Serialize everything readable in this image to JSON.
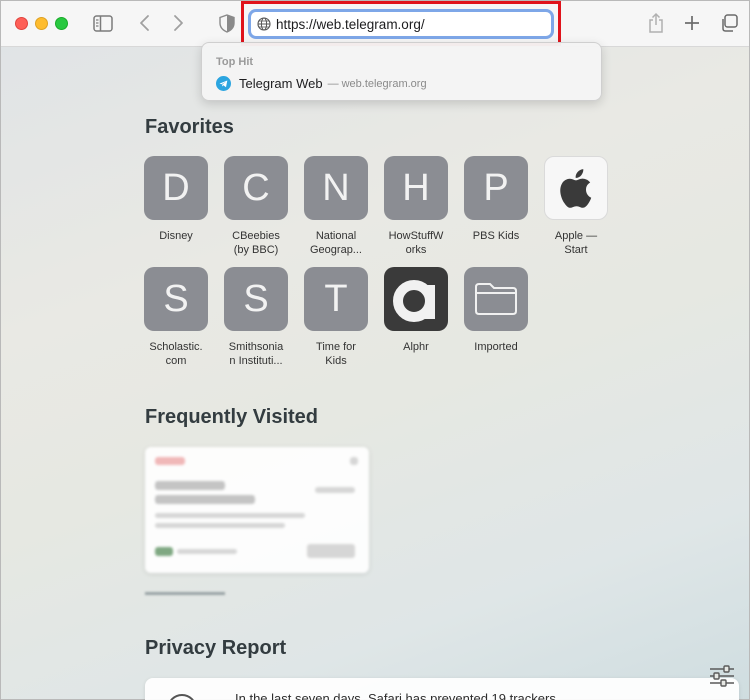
{
  "toolbar": {
    "url": "https://web.telegram.org/"
  },
  "dropdown": {
    "section_label": "Top Hit",
    "suggestion_name": "Telegram Web",
    "suggestion_separator": "—",
    "suggestion_domain": "web.telegram.org"
  },
  "favorites": {
    "title": "Favorites",
    "items": [
      {
        "letter": "D",
        "label": "Disney"
      },
      {
        "letter": "C",
        "label": "CBeebies\n(by BBC)"
      },
      {
        "letter": "N",
        "label": "National\nGeograp..."
      },
      {
        "letter": "H",
        "label": "HowStuffW\norks"
      },
      {
        "letter": "P",
        "label": "PBS Kids"
      },
      {
        "letter": "",
        "label": "Apple —\nStart"
      },
      {
        "letter": "S",
        "label": "Scholastic.\ncom"
      },
      {
        "letter": "S",
        "label": "Smithsonia\nn Instituti..."
      },
      {
        "letter": "T",
        "label": "Time for\nKids"
      },
      {
        "letter": "a",
        "label": "Alphr"
      },
      {
        "letter": "",
        "label": "Imported"
      }
    ]
  },
  "frequently_visited": {
    "title": "Frequently Visited"
  },
  "privacy_report": {
    "title": "Privacy Report",
    "summary": "In the last seven days, Safari has prevented 19 trackers"
  },
  "colors": {
    "accent": "#7ea7e8",
    "highlight": "#e0131b",
    "tile": "#8b8d93",
    "telegram": "#2ca5e0"
  }
}
